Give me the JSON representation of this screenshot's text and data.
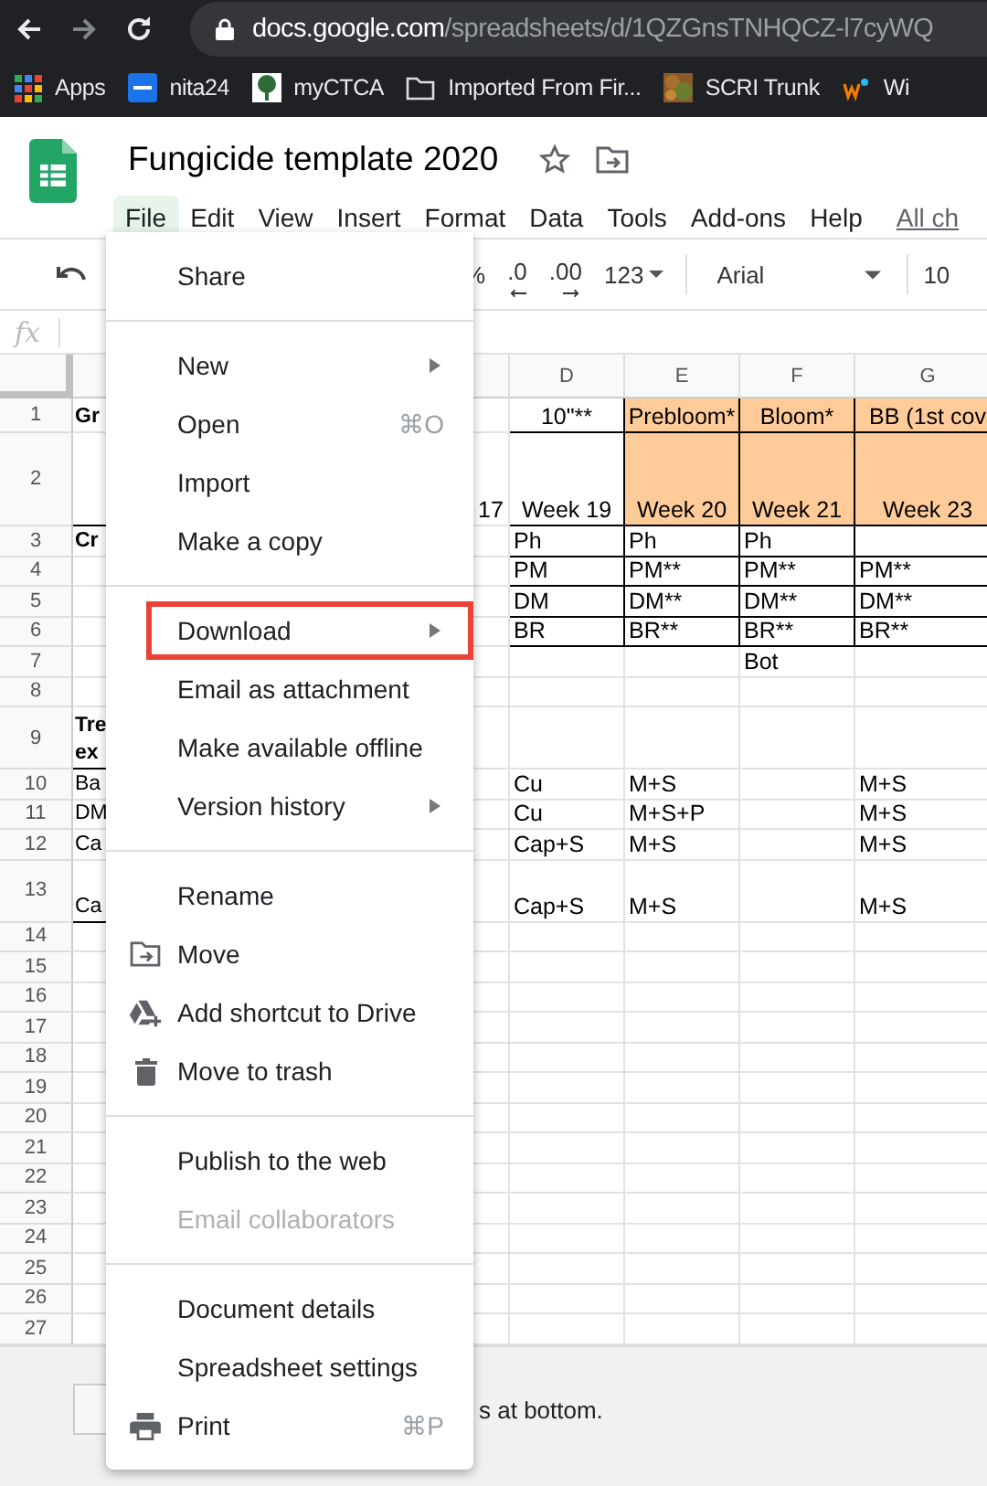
{
  "browser": {
    "back_enabled": true,
    "forward_enabled": false,
    "url_host": "docs.google.com",
    "url_path": "/spreadsheets/d/1QZGnsTNHQCZ-l7cyWQ",
    "bookmarks": [
      {
        "kind": "apps",
        "label": "Apps"
      },
      {
        "kind": "dsm",
        "label": "nita24"
      },
      {
        "kind": "tree",
        "label": "myCTCA"
      },
      {
        "kind": "folder",
        "label": "Imported From Fir..."
      },
      {
        "kind": "picture",
        "label": "SCRI Trunk"
      },
      {
        "kind": "wu",
        "label": "Wi"
      }
    ]
  },
  "document": {
    "title": "Fungicide template 2020"
  },
  "menubar": [
    {
      "label": "File",
      "selected": true
    },
    {
      "label": "Edit",
      "selected": false
    },
    {
      "label": "View",
      "selected": false
    },
    {
      "label": "Insert",
      "selected": false
    },
    {
      "label": "Format",
      "selected": false
    },
    {
      "label": "Data",
      "selected": false
    },
    {
      "label": "Tools",
      "selected": false
    },
    {
      "label": "Add-ons",
      "selected": false
    },
    {
      "label": "Help",
      "selected": false
    }
  ],
  "changes_link": "All ch",
  "toolbar": {
    "percent": "%",
    "decrease_decimals": ".0",
    "increase_decimals": ".00",
    "number_format": "123",
    "font": "Arial",
    "font_size": "10"
  },
  "formula_bar": {
    "label": "fx"
  },
  "columns": [
    {},
    {},
    {
      "label": "D"
    },
    {
      "label": "E"
    },
    {
      "label": "F"
    },
    {
      "label": "G"
    }
  ],
  "rows": [
    {
      "number": "1",
      "kind": "band",
      "bold": true,
      "boxed": true,
      "cells": [
        "Gr",
        "",
        "10\"**",
        "Prebloom*",
        "Bloom*",
        "BB (1st cov"
      ]
    },
    {
      "number": "2",
      "kind": "band_tall",
      "boxed": true,
      "cells": [
        "",
        "17",
        "Week 19",
        "Week 20",
        "Week 21",
        "Week 23"
      ]
    },
    {
      "number": "3",
      "kind": "plain",
      "bold": true,
      "boxed": true,
      "cells": [
        "Cr",
        "",
        "Ph",
        "Ph",
        "Ph",
        ""
      ]
    },
    {
      "number": "4",
      "kind": "plain",
      "boxed": true,
      "cells": [
        "",
        "",
        "PM",
        "PM**",
        "PM**",
        "PM**"
      ]
    },
    {
      "number": "5",
      "kind": "plain",
      "boxed": true,
      "cells": [
        "",
        "",
        "DM",
        "DM**",
        "DM**",
        "DM**"
      ]
    },
    {
      "number": "6",
      "kind": "plain",
      "boxed": true,
      "cells": [
        "",
        "",
        "BR",
        "BR**",
        "BR**",
        "BR**"
      ]
    },
    {
      "number": "7",
      "kind": "plain",
      "cells": [
        "",
        "",
        "",
        "",
        "Bot",
        ""
      ]
    },
    {
      "number": "8",
      "kind": "plain",
      "cells": [
        "",
        "",
        "",
        "",
        "",
        ""
      ]
    },
    {
      "number": "9",
      "kind": "tall",
      "bold": true,
      "cells": [
        "Tre ex",
        "",
        "",
        "",
        "",
        ""
      ]
    },
    {
      "number": "10",
      "kind": "plain",
      "bold": false,
      "cells": [
        "Ba",
        "",
        "Cu",
        "M+S",
        "",
        "M+S"
      ]
    },
    {
      "number": "11",
      "kind": "plain",
      "bold": false,
      "cells": [
        "DM",
        "",
        "Cu",
        "M+S+P",
        "",
        "M+S"
      ]
    },
    {
      "number": "12",
      "kind": "plain",
      "bold": false,
      "cells": [
        "Ca",
        "",
        "Cap+S",
        "M+S",
        "",
        "M+S"
      ]
    },
    {
      "number": "13",
      "kind": "tall",
      "bold": false,
      "cells": [
        "Ca",
        "",
        "Cap+S",
        "M+S",
        "",
        "M+S"
      ]
    },
    {
      "number": "14",
      "kind": "plain",
      "cells": [
        "",
        "",
        "",
        "",
        "",
        ""
      ]
    },
    {
      "number": "15",
      "kind": "plain",
      "cells": [
        "",
        "",
        "",
        "",
        "",
        ""
      ]
    },
    {
      "number": "16",
      "kind": "plain",
      "cells": [
        "",
        "",
        "",
        "",
        "",
        ""
      ]
    },
    {
      "number": "17",
      "kind": "plain",
      "cells": [
        "",
        "",
        "",
        "",
        "",
        ""
      ]
    },
    {
      "number": "18",
      "kind": "plain",
      "cells": [
        "",
        "",
        "",
        "",
        "",
        ""
      ]
    },
    {
      "number": "19",
      "kind": "plain",
      "cells": [
        "",
        "",
        "",
        "",
        "",
        ""
      ]
    },
    {
      "number": "20",
      "kind": "plain",
      "cells": [
        "",
        "",
        "",
        "",
        "",
        ""
      ]
    },
    {
      "number": "21",
      "kind": "plain",
      "cells": [
        "",
        "",
        "",
        "",
        "",
        ""
      ]
    },
    {
      "number": "22",
      "kind": "plain",
      "cells": [
        "",
        "",
        "",
        "",
        "",
        ""
      ]
    },
    {
      "number": "23",
      "kind": "plain",
      "cells": [
        "",
        "",
        "",
        "",
        "",
        ""
      ]
    },
    {
      "number": "24",
      "kind": "plain",
      "cells": [
        "",
        "",
        "",
        "",
        "",
        ""
      ]
    },
    {
      "number": "25",
      "kind": "plain",
      "cells": [
        "",
        "",
        "",
        "",
        "",
        ""
      ]
    },
    {
      "number": "26",
      "kind": "plain",
      "cells": [
        "",
        "",
        "",
        "",
        "",
        ""
      ]
    },
    {
      "number": "27",
      "kind": "plain",
      "cells": [
        "",
        "",
        "",
        "",
        "",
        ""
      ]
    }
  ],
  "footer_text": "s at bottom.",
  "file_menu": [
    [
      {
        "label": "Share",
        "disabled": false,
        "highlighted": false
      }
    ],
    [
      {
        "label": "New",
        "submenu": true,
        "disabled": false,
        "highlighted": false
      },
      {
        "label": "Open",
        "shortcut": "⌘O",
        "disabled": false,
        "highlighted": false
      },
      {
        "label": "Import",
        "disabled": false,
        "highlighted": false
      },
      {
        "label": "Make a copy",
        "disabled": false,
        "highlighted": false
      }
    ],
    [
      {
        "label": "Download",
        "submenu": true,
        "disabled": false,
        "highlighted": true
      },
      {
        "label": "Email as attachment",
        "disabled": false,
        "highlighted": false
      },
      {
        "label": "Make available offline",
        "disabled": false,
        "highlighted": false
      },
      {
        "label": "Version history",
        "submenu": true,
        "disabled": false,
        "highlighted": false
      }
    ],
    [
      {
        "label": "Rename",
        "disabled": false,
        "highlighted": false
      },
      {
        "label": "Move",
        "kind": "move",
        "disabled": false,
        "highlighted": false
      },
      {
        "label": "Add shortcut to Drive",
        "kind": "shortcut",
        "disabled": false,
        "highlighted": false
      },
      {
        "label": "Move to trash",
        "kind": "trash",
        "disabled": false,
        "highlighted": false
      }
    ],
    [
      {
        "label": "Publish to the web",
        "disabled": false,
        "highlighted": false
      },
      {
        "label": "Email collaborators",
        "disabled": true,
        "highlighted": false
      }
    ],
    [
      {
        "label": "Document details",
        "disabled": false,
        "highlighted": false
      },
      {
        "label": "Spreadsheet settings",
        "disabled": false,
        "highlighted": false
      },
      {
        "label": "Print",
        "kind": "print",
        "shortcut": "⌘P",
        "disabled": false,
        "highlighted": false
      }
    ]
  ]
}
